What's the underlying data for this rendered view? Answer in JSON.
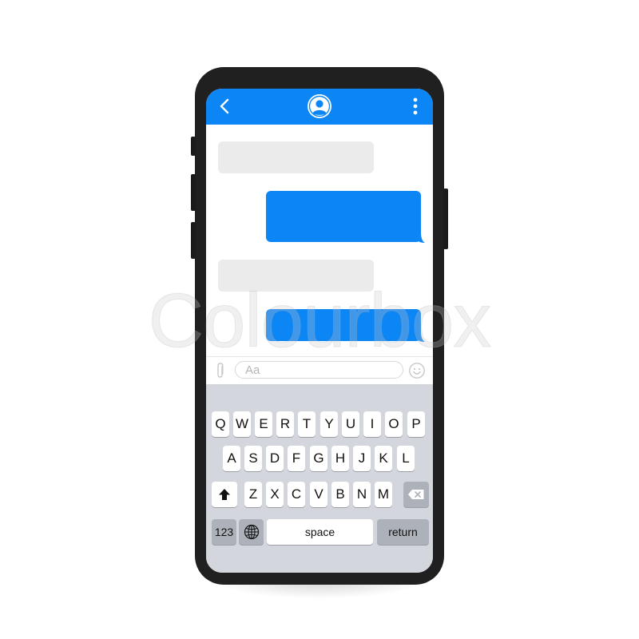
{
  "colors": {
    "accent": "#0d86f5",
    "incoming_bubble": "#ebebeb",
    "keyboard_bg": "#d3d6dc",
    "key_fn": "#acb1ba",
    "phone_frame": "#202020"
  },
  "header": {
    "icons": [
      "back-chevron-icon",
      "avatar-icon",
      "more-vertical-icon"
    ]
  },
  "chat": {
    "messages": [
      {
        "direction": "incoming"
      },
      {
        "direction": "outgoing"
      },
      {
        "direction": "incoming"
      },
      {
        "direction": "outgoing"
      }
    ]
  },
  "composer": {
    "placeholder": "Aa",
    "icons": [
      "paperclip-icon",
      "emoji-icon"
    ]
  },
  "keyboard": {
    "row1": [
      "Q",
      "W",
      "E",
      "R",
      "T",
      "Y",
      "U",
      "I",
      "O",
      "P"
    ],
    "row2": [
      "A",
      "S",
      "D",
      "F",
      "G",
      "H",
      "J",
      "K",
      "L"
    ],
    "row3": [
      "Z",
      "X",
      "C",
      "V",
      "B",
      "N",
      "M"
    ],
    "numbers_label": "123",
    "space_label": "space",
    "return_label": "return",
    "icons": [
      "shift-icon",
      "backspace-icon",
      "globe-icon"
    ]
  },
  "watermark": "Colourbox"
}
